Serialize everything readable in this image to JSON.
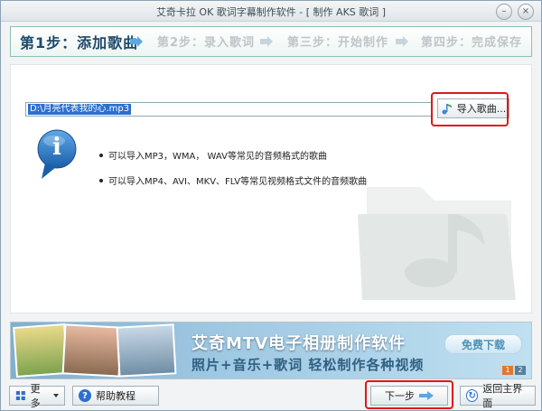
{
  "window": {
    "title": "艾奇卡拉 OK 歌词字幕制作软件 - [ 制作 AKS 歌词 ]",
    "min_glyph": "–",
    "close_glyph": "×"
  },
  "steps": [
    {
      "label": "第1步：添加歌曲"
    },
    {
      "label": "第2步：录入歌词"
    },
    {
      "label": "第三步：开始制作"
    },
    {
      "label": "第四步：完成保存"
    }
  ],
  "file": {
    "path": "D:\\月亮代表我的心.mp3",
    "import_label": "导入歌曲..."
  },
  "info": {
    "letter": "i",
    "bullets": [
      "可以导入MP3，WMA， WAV等常见的音频格式的歌曲",
      "可以导入MP4、AVI、MKV、FLV等常见视频格式文件的音频歌曲"
    ]
  },
  "banner": {
    "title": "艾奇MTV电子相册制作软件",
    "subtitle": "照片+音乐+歌词 轻松制作各种视频",
    "download_label": "免费下载",
    "pages": [
      "1",
      "2"
    ]
  },
  "bottom": {
    "more_label": "更多",
    "help_label": "帮助教程",
    "next_label": "下一步",
    "home_label": "返回主界面"
  },
  "colors": {
    "accent": "#2c6fcf",
    "highlight": "#e01818",
    "step_active": "#1f4a6a"
  }
}
